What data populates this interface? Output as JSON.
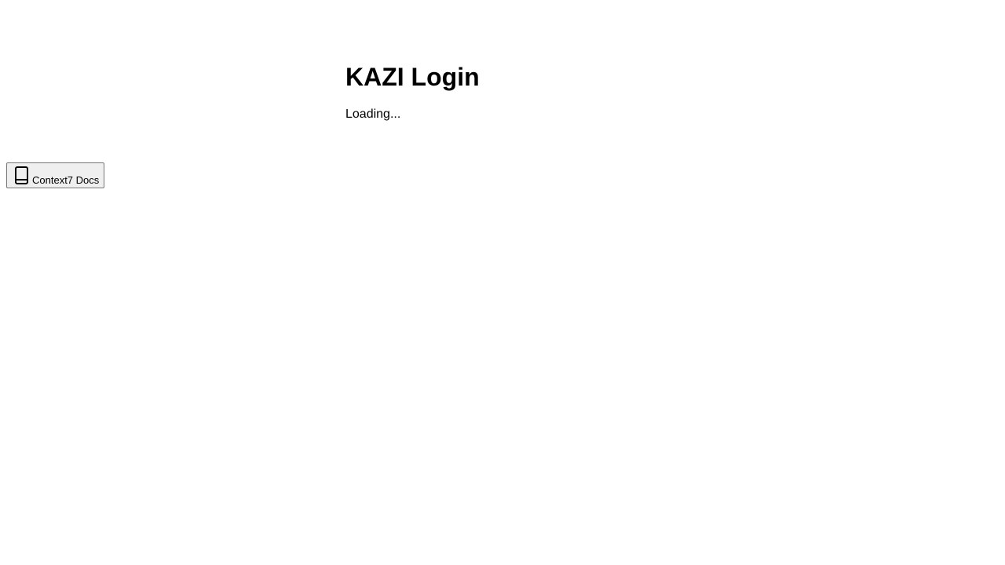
{
  "login": {
    "title": "KAZI Login",
    "status": "Loading..."
  },
  "docs_button": {
    "label": "Context7 Docs",
    "icon": "book-icon"
  }
}
